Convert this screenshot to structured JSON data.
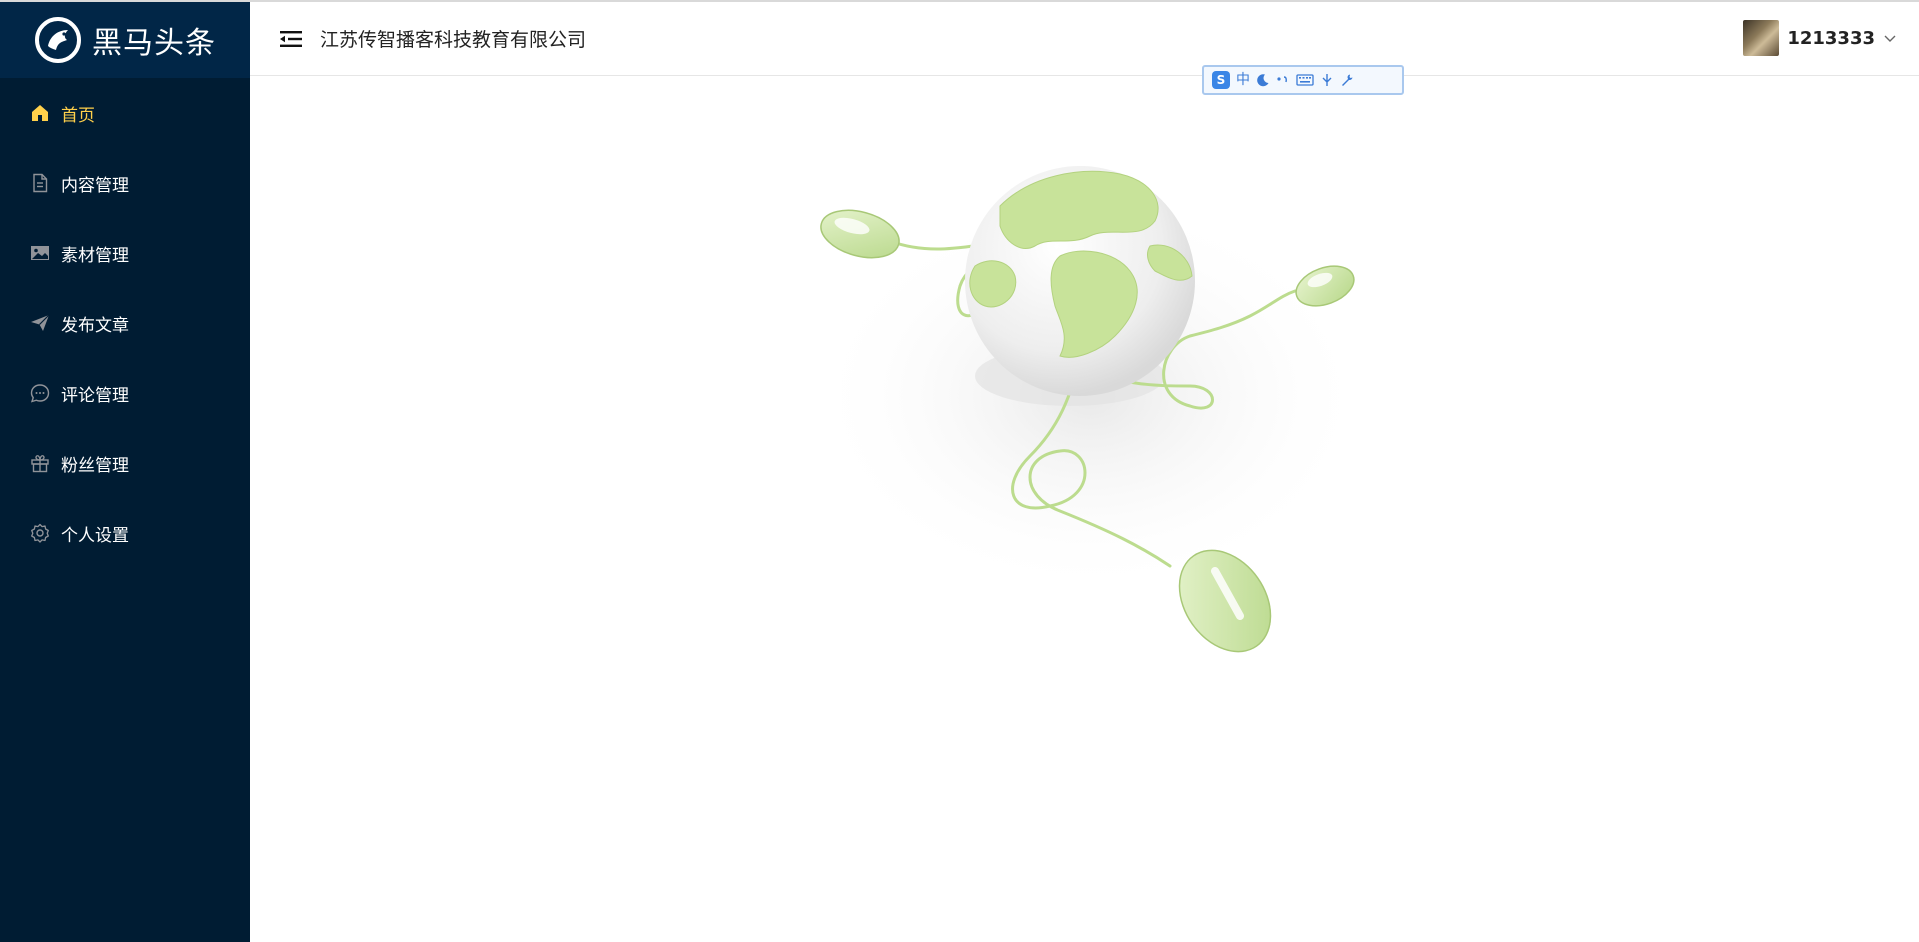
{
  "brand": {
    "name": "黑马头条"
  },
  "sidebar": {
    "items": [
      {
        "label": "首页",
        "icon": "home-icon",
        "active": true
      },
      {
        "label": "内容管理",
        "icon": "document-icon",
        "active": false
      },
      {
        "label": "素材管理",
        "icon": "image-icon",
        "active": false
      },
      {
        "label": "发布文章",
        "icon": "send-icon",
        "active": false
      },
      {
        "label": "评论管理",
        "icon": "comment-icon",
        "active": false
      },
      {
        "label": "粉丝管理",
        "icon": "gift-icon",
        "active": false
      },
      {
        "label": "个人设置",
        "icon": "gear-icon",
        "active": false
      }
    ]
  },
  "header": {
    "company": "江苏传智播客科技教育有限公司",
    "user": {
      "name": "1213333"
    }
  },
  "ime": {
    "mode": "中"
  },
  "colors": {
    "sidebar_bg": "#001c33",
    "logo_bg": "#012647",
    "active_text": "#ffd04b",
    "globe_green": "#c8e39a"
  }
}
